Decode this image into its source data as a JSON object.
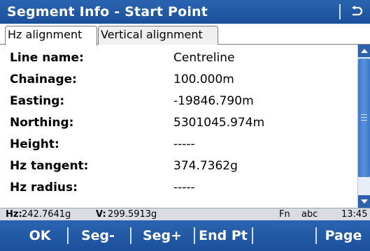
{
  "window": {
    "title": "Segment Info - Start Point",
    "back_icon": "return-arrow-icon"
  },
  "tabs": [
    {
      "label": "Hz alignment",
      "active": true
    },
    {
      "label": "Vertical alignment",
      "active": false
    }
  ],
  "fields": [
    {
      "label": "Line name:",
      "value": "Centreline"
    },
    {
      "label": "Chainage:",
      "value": "100.000m"
    },
    {
      "label": "Easting:",
      "value": "-19846.790m"
    },
    {
      "label": "Northing:",
      "value": "5301045.974m"
    },
    {
      "label": "Height:",
      "value": "-----"
    },
    {
      "label": "Hz tangent:",
      "value": "374.7362g"
    },
    {
      "label": "Hz radius:",
      "value": "-----"
    }
  ],
  "status": {
    "hz_label": "Hz:",
    "hz_value": "242.7641g",
    "v_label": "V:",
    "v_value": "299.5913g",
    "fn": "Fn",
    "input_mode": "abc",
    "time": "13:45"
  },
  "softkeys": {
    "ok": "OK",
    "seg_minus": "Seg-",
    "seg_plus": "Seg+",
    "end_pt": "End Pt",
    "page": "Page"
  },
  "colors": {
    "accent": "#1f5aa6",
    "status_bg": "#d9dde3"
  }
}
